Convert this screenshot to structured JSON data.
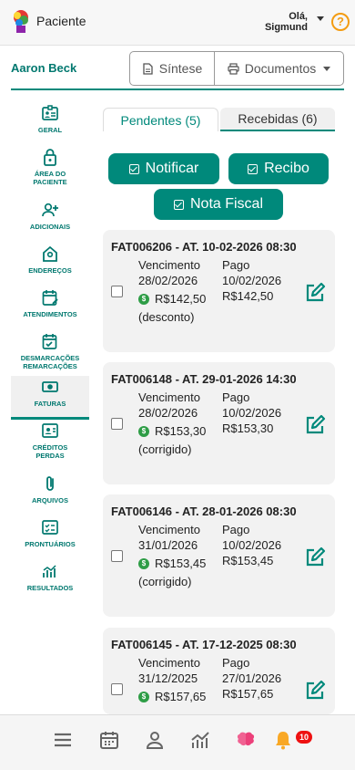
{
  "header": {
    "app_title": "Paciente",
    "greeting": "Olá,",
    "user_name": "Sigmund",
    "help_symbol": "?"
  },
  "patient": {
    "name": "Aaron Beck"
  },
  "toolbar": {
    "sintese_label": "Síntese",
    "documentos_label": "Documentos"
  },
  "sidebar": {
    "items": [
      {
        "label": "GERAL",
        "icon": "id-card-icon"
      },
      {
        "label": "ÁREA DO PACIENTE",
        "icon": "lock-icon"
      },
      {
        "label": "ADICIONAIS",
        "icon": "person-add-icon"
      },
      {
        "label": "ENDEREÇOS",
        "icon": "home-pin-icon"
      },
      {
        "label": "ATENDIMENTOS",
        "icon": "calendar-edit-icon"
      },
      {
        "label": "DESMARCAÇÕES REMARCAÇÕES",
        "icon": "calendar-check-icon"
      },
      {
        "label": "FATURAS",
        "icon": "money-icon",
        "active": true
      },
      {
        "label": "CRÉDITOS PERDAS",
        "icon": "badge-icon"
      },
      {
        "label": "ARQUIVOS",
        "icon": "paperclip-icon"
      },
      {
        "label": "PRONTUÁRIOS",
        "icon": "checklist-icon"
      },
      {
        "label": "RESULTADOS",
        "icon": "chart-icon"
      }
    ]
  },
  "tabs": {
    "pendentes": "Pendentes (5)",
    "recebidas": "Recebidas (6)",
    "active": "recebidas"
  },
  "actions": {
    "notificar": "Notificar",
    "recibo": "Recibo",
    "nota_fiscal": "Nota Fiscal"
  },
  "invoices": [
    {
      "title": "FAT006206 - AT. 10-02-2026 08:30",
      "vencimento_label": "Vencimento",
      "vencimento": "28/02/2026",
      "amount": "R$142,50",
      "note": "(desconto)",
      "pago_label": "Pago",
      "pago_date": "10/02/2026",
      "pago_amount": "R$142,50"
    },
    {
      "title": "FAT006148 - AT. 29-01-2026 14:30",
      "vencimento_label": "Vencimento",
      "vencimento": "28/02/2026",
      "amount": "R$153,30",
      "note": "(corrigido)",
      "pago_label": "Pago",
      "pago_date": "10/02/2026",
      "pago_amount": "R$153,30"
    },
    {
      "title": "FAT006146 - AT. 28-01-2026 08:30",
      "vencimento_label": "Vencimento",
      "vencimento": "31/01/2026",
      "amount": "R$153,45",
      "note": "(corrigido)",
      "pago_label": "Pago",
      "pago_date": "10/02/2026",
      "pago_amount": "R$153,45"
    },
    {
      "title": "FAT006145 - AT. 17-12-2025 08:30",
      "vencimento_label": "Vencimento",
      "vencimento": "31/12/2025",
      "amount": "R$157,65",
      "note": "",
      "pago_label": "Pago",
      "pago_date": "27/01/2026",
      "pago_amount": "R$157,65"
    }
  ],
  "bottom_nav": {
    "notifications_count": "10"
  },
  "colors": {
    "primary": "#00897b",
    "accent_orange": "#f39c12",
    "coin_green": "#2e9d46",
    "badge_red": "#e11111"
  }
}
